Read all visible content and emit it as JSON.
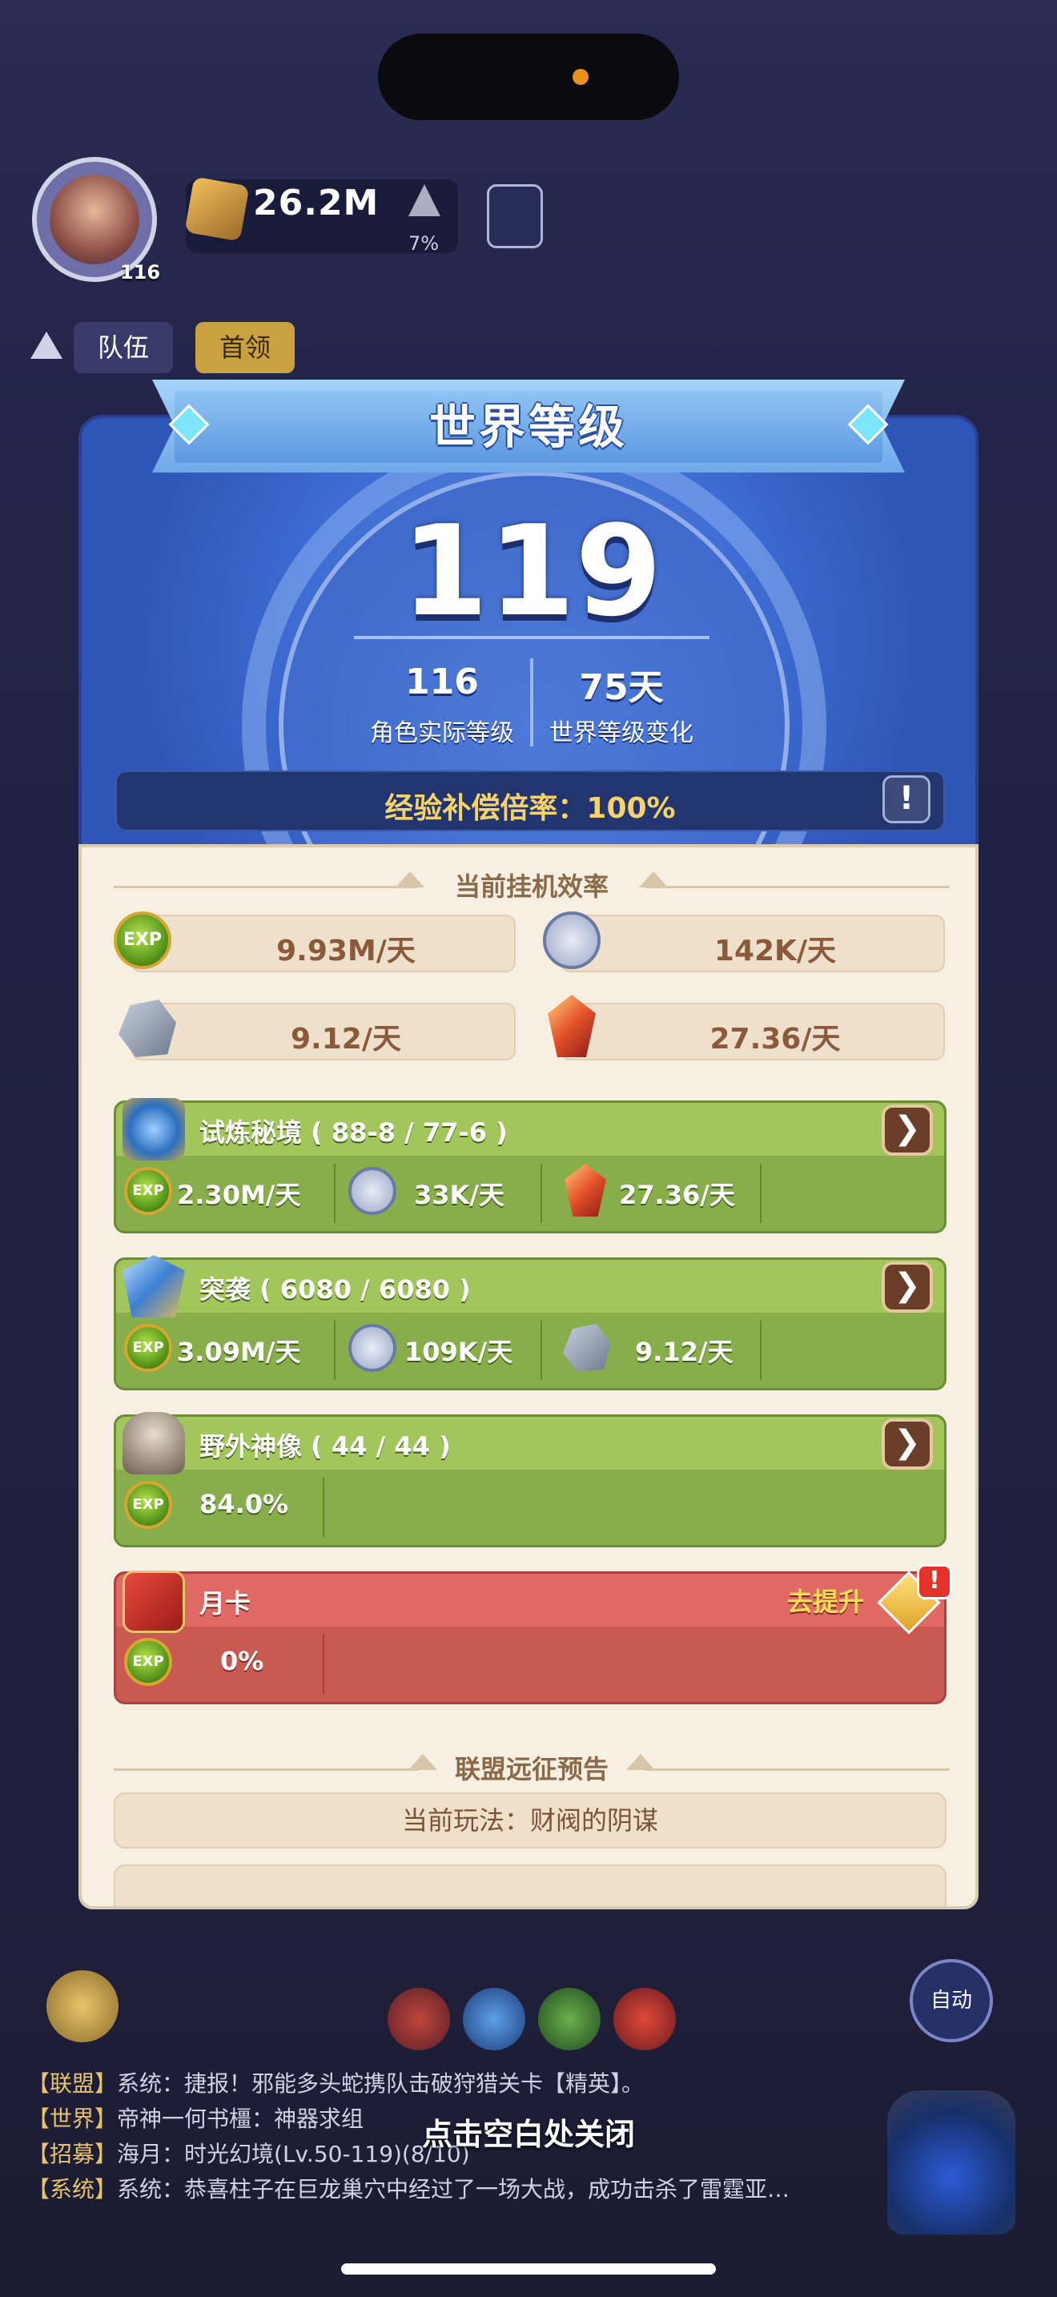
{
  "hud": {
    "level": "116",
    "power": "26.2M",
    "power_pct": "7%",
    "tabs": [
      "队伍",
      "首领"
    ]
  },
  "modal": {
    "title": "世界等级",
    "world_level": "119",
    "stats": [
      {
        "value": "116",
        "label": "角色实际等级"
      },
      {
        "value": "75天",
        "label": "世界等级变化"
      }
    ],
    "exp_rate": "经验补偿倍率：100%",
    "alert_symbol": "!",
    "efficiency": {
      "title": "当前挂机效率",
      "items": [
        {
          "icon": "exp-icon",
          "value": "9.93M/天"
        },
        {
          "icon": "silver-coin-icon",
          "value": "142K/天"
        },
        {
          "icon": "stone-icon",
          "value": "9.12/天"
        },
        {
          "icon": "crystal-icon",
          "value": "27.36/天"
        }
      ]
    },
    "sources": [
      {
        "title": "试炼秘境 ( 88-8 / 77-6 )",
        "icon": "trial-realm-icon",
        "cells": [
          {
            "icon": "exp-icon",
            "value": "2.30M/天"
          },
          {
            "icon": "silver-coin-icon",
            "value": "33K/天"
          },
          {
            "icon": "crystal-icon",
            "value": "27.36/天"
          }
        ]
      },
      {
        "title": "突袭 ( 6080 / 6080 )",
        "icon": "raid-icon",
        "cells": [
          {
            "icon": "exp-icon",
            "value": "3.09M/天"
          },
          {
            "icon": "silver-coin-icon",
            "value": "109K/天"
          },
          {
            "icon": "stone-icon",
            "value": "9.12/天"
          }
        ]
      },
      {
        "title": "野外神像 ( 44 / 44 )",
        "icon": "statue-icon",
        "cells": [
          {
            "icon": "exp-icon",
            "value": "84.0%"
          }
        ]
      },
      {
        "title": "月卡",
        "icon": "monthly-card-icon",
        "upgrade_label": "去提升",
        "cells": [
          {
            "icon": "exp-icon",
            "value": "0%"
          }
        ]
      }
    ],
    "go_symbol": "❯",
    "alliance": {
      "title": "联盟远征预告",
      "current_play": "当前玩法：财阀的阴谋"
    }
  },
  "chat": [
    {
      "tag": "【联盟】",
      "text": "系统：捷报！邪能多头蛇携队击破狩猎关卡【精英】。"
    },
    {
      "tag": "【世界】",
      "text": "帝神一何书橿：神器求组"
    },
    {
      "tag": "【招募】",
      "text": "海月：时光幻境(Lv.50-119)(8/10)"
    },
    {
      "tag": "【系统】",
      "text": "系统：恭喜柱子在巨龙巢穴中经过了一场大战，成功击杀了雷霆亚…"
    }
  ],
  "auto_label": "自动",
  "close_hint": "点击空白处关闭",
  "colors": {
    "banner": "#6fa9ea",
    "exp_rate_text": "#f6d36a",
    "card_green": "#88ad4b",
    "card_red": "#c85a52"
  }
}
